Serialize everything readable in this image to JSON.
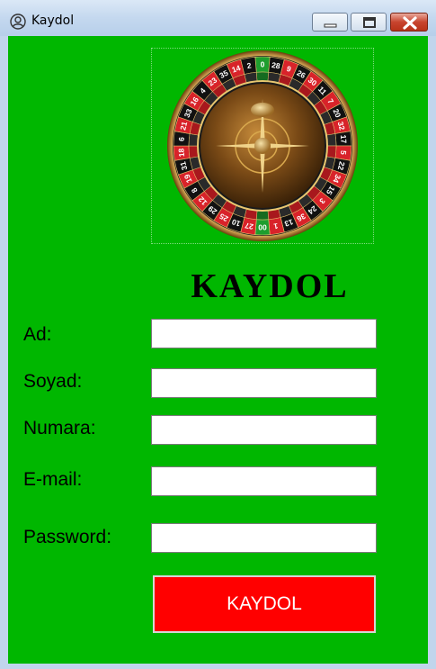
{
  "window": {
    "title": "Kaydol",
    "icon": "user-circle-icon",
    "controls": [
      "minimize-icon",
      "maximize-icon",
      "close-icon"
    ]
  },
  "logo": {
    "icon": "roulette-wheel-icon",
    "numbers": [
      "0",
      "28",
      "9",
      "26",
      "30",
      "11",
      "7",
      "20",
      "32",
      "17",
      "5",
      "22",
      "34",
      "15",
      "3",
      "24",
      "36",
      "13",
      "1",
      "00",
      "27",
      "10",
      "25",
      "29",
      "12",
      "8",
      "19",
      "31",
      "18",
      "6",
      "21",
      "33",
      "16",
      "4",
      "23",
      "35",
      "14",
      "2"
    ]
  },
  "form": {
    "heading": "KAYDOL",
    "fields": [
      {
        "label": "Ad:",
        "value": ""
      },
      {
        "label": "Soyad:",
        "value": ""
      },
      {
        "label": "Numara:",
        "value": ""
      },
      {
        "label": "E-mail:",
        "value": ""
      },
      {
        "label": "Password:",
        "value": ""
      }
    ],
    "submit_label": "KAYDOL"
  },
  "colors": {
    "background": "#00b700",
    "button": "#ff0000",
    "button_text": "#ffffff"
  }
}
